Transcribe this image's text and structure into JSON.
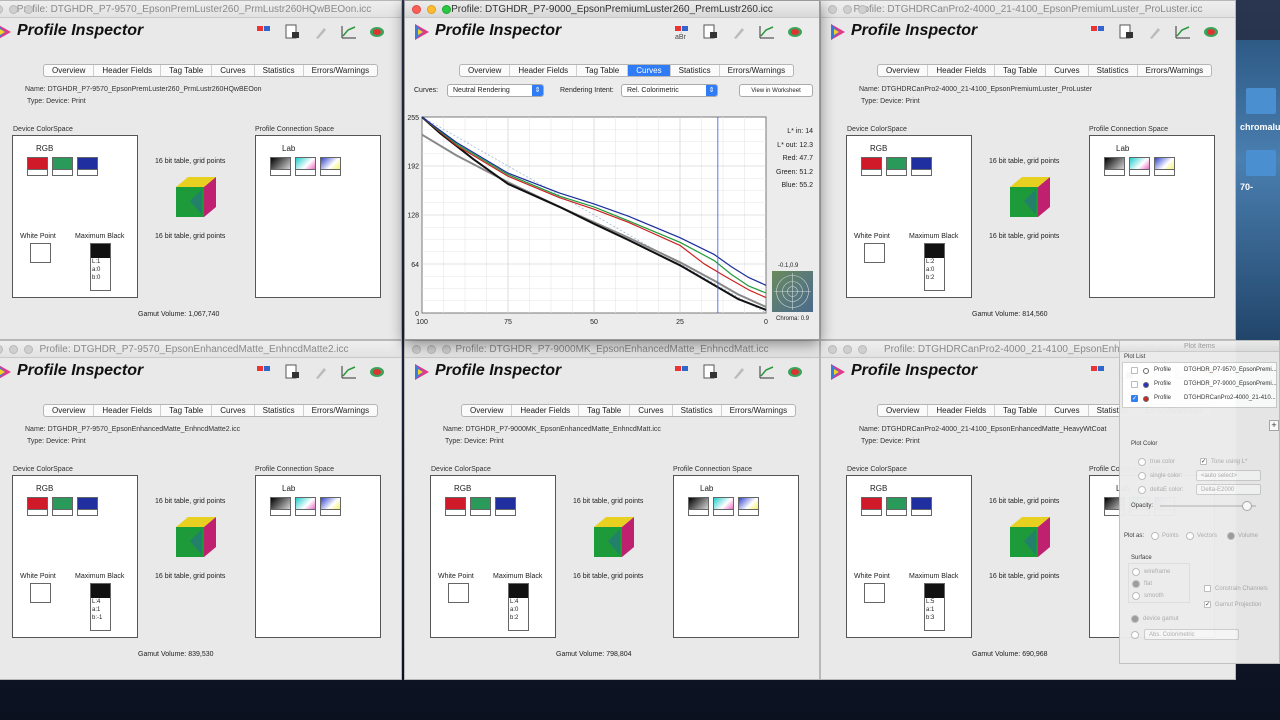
{
  "app": {
    "name": "Profile Inspector",
    "tabs": [
      "Overview",
      "Header Fields",
      "Tag Table",
      "Curves",
      "Statistics",
      "Errors/Warnings"
    ]
  },
  "labels": {
    "name_prefix": "Name: ",
    "type_line": "Type: Device: Print",
    "device_colorspace": "Device ColorSpace",
    "profile_connection_space": "Profile Connection Space",
    "rgb": "RGB",
    "lab": "Lab",
    "table_info": "16 bit table,  grid points",
    "white_point": "White Point",
    "maximum_black": "Maximum Black",
    "gamut_prefix": "Gamut Volume: "
  },
  "windows": [
    {
      "id": "w1",
      "title": "Profile: DTGHDR_P7-9570_EpsonPremLuster260_PrmLustr260HQwBEOon.icc",
      "name": "DTGHDR_P7-9570_EpsonPremLuster260_PrmLustr260HQwBEOon",
      "black_lab": [
        "L:1",
        "a:0",
        "b:0"
      ],
      "gamut": "1,067,740"
    },
    {
      "id": "w3",
      "title": "Profile: DTGHDRCanPro2-4000_21-4100_EpsonPremiumLuster_ProLuster.icc",
      "name": "DTGHDRCanPro2-4000_21-4100_EpsonPremiumLuster_ProLuster",
      "black_lab": [
        "L:2",
        "a:0",
        "b:2"
      ],
      "gamut": "814,560"
    },
    {
      "id": "w4",
      "title": "Profile: DTGHDR_P7-9570_EpsonEnhancedMatte_EnhncdMatte2.icc",
      "name": "DTGHDR_P7-9570_EpsonEnhancedMatte_EnhncdMatte2.icc",
      "black_lab": [
        "L:4",
        "a:1",
        "b:-1"
      ],
      "gamut": "839,530"
    },
    {
      "id": "w5",
      "title": "Profile: DTGHDR_P7-9000MK_EpsonEnhancedMatte_EnhncdMatt.icc",
      "name": "DTGHDR_P7-9000MK_EpsonEnhancedMatte_EnhncdMatt.icc",
      "black_lab": [
        "L:4",
        "a:0",
        "b:2"
      ],
      "gamut": "798,804"
    },
    {
      "id": "w6",
      "title": "Profile: DTGHDRCanPro2-4000_21-4100_EpsonEnhancedMatte",
      "name": "DTGHDRCanPro2-4000_21-4100_EpsonEnhancedMatte_HeavyWtCoat",
      "black_lab": [
        "L:5",
        "a:1",
        "b:3"
      ],
      "gamut": "690,968"
    }
  ],
  "front": {
    "title": "Profile: DTGHDR_P7-9000_EpsonPremiumLuster260_PremLustr260.icc",
    "active_tab": "Curves",
    "curves_label": "Curves:",
    "curves_value": "Neutral Rendering",
    "intent_label": "Rendering Intent:",
    "intent_value": "Rel. Colorimetric",
    "worksheet_button": "View in Worksheet",
    "readout": [
      {
        "k": "L* in:",
        "v": "14"
      },
      {
        "k": "L* out:",
        "v": "12.3"
      },
      {
        "k": "Red:",
        "v": "47.7"
      },
      {
        "k": "Green:",
        "v": "51.2"
      },
      {
        "k": "Blue:",
        "v": "55.2"
      }
    ],
    "chroma_ab": "-0.1,0.9",
    "chroma_label": "Chroma:",
    "chroma_value": "0.9"
  },
  "chart_data": {
    "type": "line",
    "title": "",
    "xlabel": "",
    "ylabel": "",
    "xlim": [
      100,
      0
    ],
    "ylim": [
      0,
      255
    ],
    "x_ticks": [
      "100",
      "75",
      "50",
      "25",
      "0"
    ],
    "y_ticks": [
      "0",
      "64",
      "128",
      "192",
      "255"
    ],
    "grid": true,
    "cursor_x": 14,
    "series": [
      {
        "color": "#888888",
        "x": [
          100,
          90,
          75,
          60,
          50,
          40,
          25,
          15,
          8,
          0
        ],
        "y": [
          232,
          205,
          170,
          138,
          118,
          98,
          66,
          42,
          24,
          8
        ]
      },
      {
        "color": "#111111",
        "x": [
          100,
          95,
          85,
          75,
          60,
          50,
          40,
          25,
          15,
          8,
          0
        ],
        "y": [
          255,
          235,
          200,
          168,
          138,
          116,
          95,
          62,
          36,
          18,
          4
        ]
      },
      {
        "color": "#cc2222",
        "x": [
          100,
          90,
          75,
          60,
          50,
          40,
          25,
          18,
          12,
          5,
          0
        ],
        "y": [
          255,
          218,
          178,
          150,
          135,
          118,
          88,
          64,
          48,
          30,
          20
        ]
      },
      {
        "color": "#1f9a3a",
        "x": [
          100,
          90,
          75,
          60,
          50,
          40,
          25,
          15,
          10,
          5,
          0
        ],
        "y": [
          255,
          220,
          180,
          152,
          138,
          120,
          92,
          68,
          50,
          35,
          26
        ]
      },
      {
        "color": "#1a2d9a",
        "x": [
          100,
          90,
          75,
          60,
          50,
          40,
          25,
          15,
          10,
          5,
          0
        ],
        "y": [
          255,
          222,
          182,
          156,
          142,
          126,
          98,
          76,
          60,
          46,
          36
        ]
      }
    ]
  },
  "plot_panel": {
    "title": "Plot Items",
    "list_label": "Plot List",
    "items": [
      {
        "label": "Profile",
        "name": "DTGHDR_P7-9570_EpsonPremi...",
        "checked": false,
        "dot": "#ffffff"
      },
      {
        "label": "Profile",
        "name": "DTGHDR_P7-9000_EpsonPremi...",
        "checked": false,
        "dot": "#2030c0"
      },
      {
        "label": "Profile",
        "name": "DTGHDRCanPro2-4000_21-410...",
        "checked": true,
        "dot": "#d02020"
      }
    ],
    "plot_color": "Plot Color",
    "true_color": "true color",
    "tone_using": "Tone using L*",
    "single_color": "single color:",
    "auto_select": "<auto select>",
    "deltaE_color": "deltaE color:",
    "deltaE_value": "Delta-E2000",
    "opacity": "Opacity:",
    "plot_as": "Plot as:",
    "points": "Points",
    "vectors": "Vectors",
    "volume": "Volume",
    "surface": "Surface",
    "wireframe": "wireframe",
    "flat": "flat",
    "smooth": "smooth",
    "constrain": "Constrain Channels",
    "gamut_projection": "Gamut Projection",
    "device_gamut": "device gamut",
    "abs_colorimetric": "Abs. Colorimetric"
  },
  "desktop": {
    "label1": "chromalux",
    "label2": "70-"
  }
}
